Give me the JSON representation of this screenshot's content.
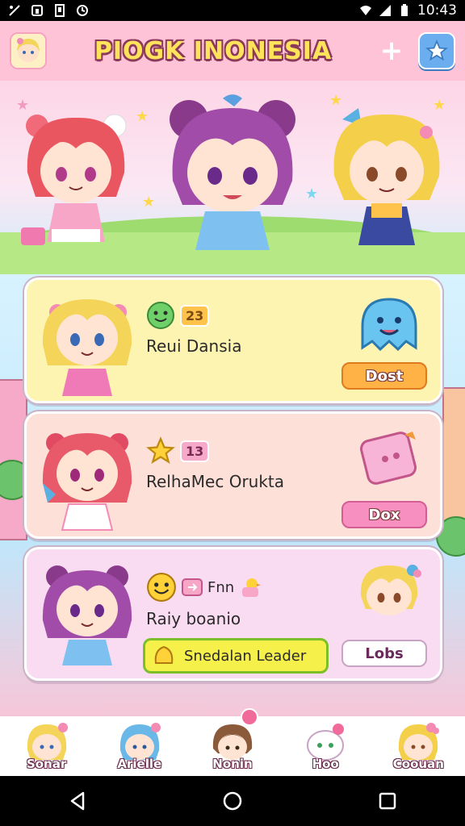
{
  "status_bar": {
    "time": "10:43"
  },
  "header": {
    "title": "PIOGK INONESIA",
    "plus_label": "+"
  },
  "cards": [
    {
      "name": "Reui Dansia",
      "badge": "23",
      "button": "Dost"
    },
    {
      "name": "RelhaMec Orukta",
      "badge": "13",
      "button": "Dox"
    },
    {
      "name": "Raiy boanio",
      "tag": "Fnn",
      "leader_button": "Snedalan Leader",
      "button": "Lobs"
    }
  ],
  "bottom_nav": [
    {
      "label": "Sonar"
    },
    {
      "label": "Arielle"
    },
    {
      "label": "Nonin"
    },
    {
      "label": "Hoo"
    },
    {
      "label": "Coouan"
    }
  ],
  "colors": {
    "header_bg": "#ffc3d8",
    "title": "#ffe35a",
    "card1": "#fdf4b2",
    "card2": "#fde0d8",
    "card3": "#f9dcf1"
  }
}
